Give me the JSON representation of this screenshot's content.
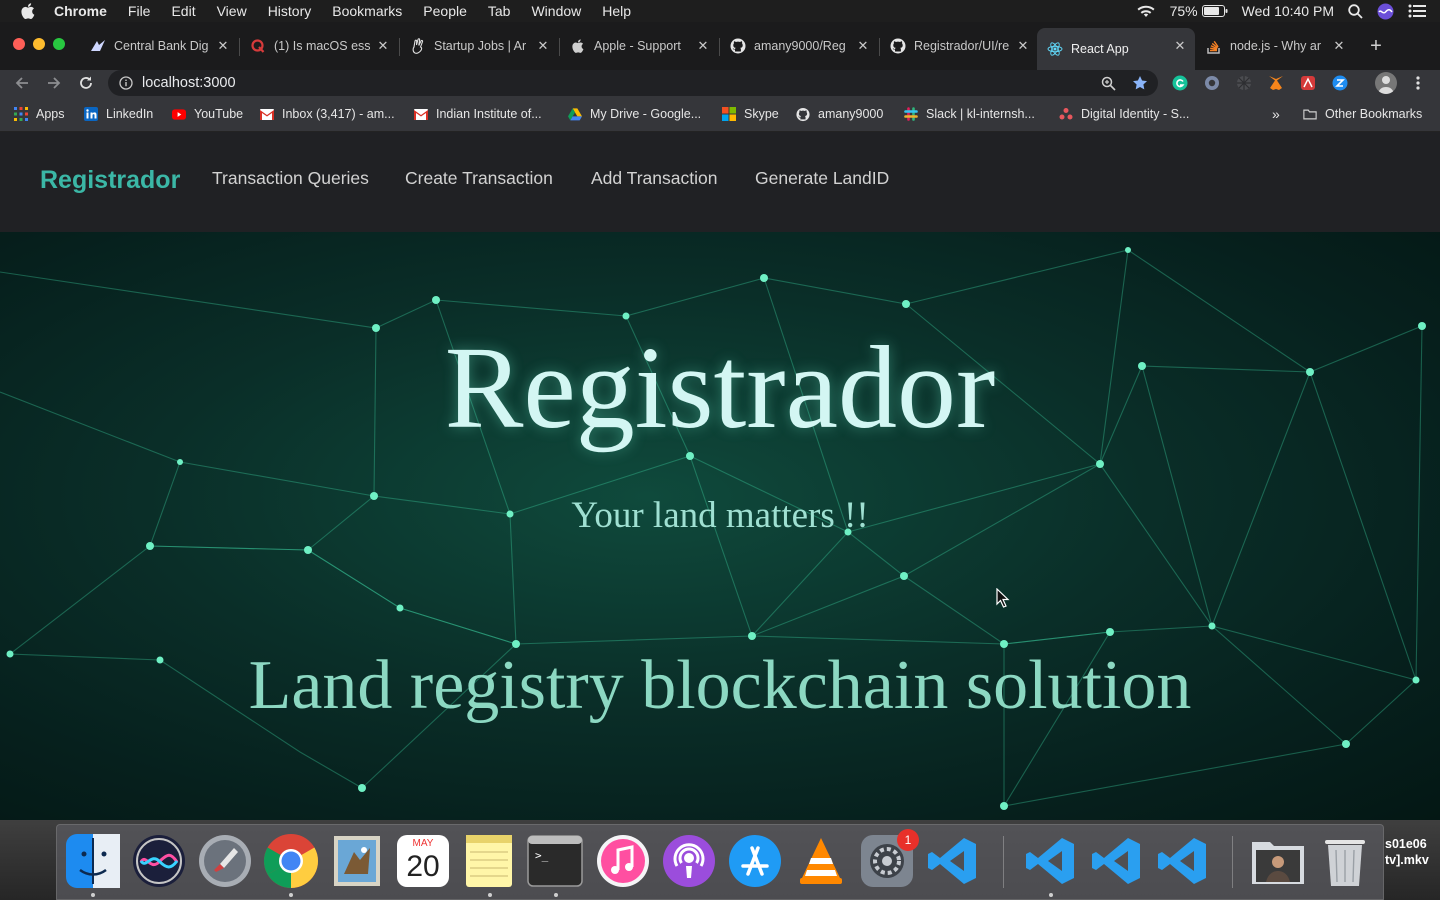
{
  "menubar": {
    "app": "Chrome",
    "items": [
      "File",
      "Edit",
      "View",
      "History",
      "Bookmarks",
      "People",
      "Tab",
      "Window",
      "Help"
    ],
    "battery": "75%",
    "clock": "Wed 10:40 PM"
  },
  "tabs": [
    {
      "title": "Central Bank Dig",
      "icon": "cbdc-icon"
    },
    {
      "title": "(1) Is macOS ess",
      "icon": "quora-icon"
    },
    {
      "title": "Startup Jobs | Ar",
      "icon": "angellist-icon"
    },
    {
      "title": "Apple - Support",
      "icon": "apple-icon"
    },
    {
      "title": "amany9000/Reg",
      "icon": "github-icon"
    },
    {
      "title": "Registrador/UI/re",
      "icon": "github-icon"
    },
    {
      "title": "React App",
      "icon": "react-icon",
      "active": true
    },
    {
      "title": "node.js - Why ar",
      "icon": "stackoverflow-icon"
    }
  ],
  "address": {
    "url": "localhost:3000"
  },
  "bookmarks": [
    {
      "label": "Apps",
      "icon": "apps-grid-icon"
    },
    {
      "label": "LinkedIn",
      "icon": "linkedin-icon"
    },
    {
      "label": "YouTube",
      "icon": "youtube-icon"
    },
    {
      "label": "Inbox (3,417) - am...",
      "icon": "gmail-icon"
    },
    {
      "label": "Indian Institute of...",
      "icon": "gmail-icon"
    },
    {
      "label": "My Drive - Google...",
      "icon": "drive-icon"
    },
    {
      "label": "Skype",
      "icon": "microsoft-icon"
    },
    {
      "label": "amany9000",
      "icon": "github-icon"
    },
    {
      "label": "Slack | kl-internsh...",
      "icon": "slack-icon"
    },
    {
      "label": "Digital Identity - S...",
      "icon": "people-icon"
    }
  ],
  "bookmarks_overflow": "»",
  "other_bookmarks": "Other Bookmarks",
  "app": {
    "brand": "Registrador",
    "nav": [
      "Transaction Queries",
      "Create Transaction",
      "Add Transaction",
      "Generate LandID"
    ],
    "hero_title": "Registrador",
    "hero_subtitle": "Your land matters !!",
    "hero_tagline": "Land registry blockchain solution"
  },
  "dock": {
    "calendar_month": "MAY",
    "calendar_day": "20",
    "settings_badge": "1",
    "desktop_file": [
      "s01e06",
      "tv].mkv"
    ]
  },
  "colors": {
    "brand": "#3bb7a6",
    "nav_bg": "#202124",
    "hero_bg": "#0a2e28"
  }
}
